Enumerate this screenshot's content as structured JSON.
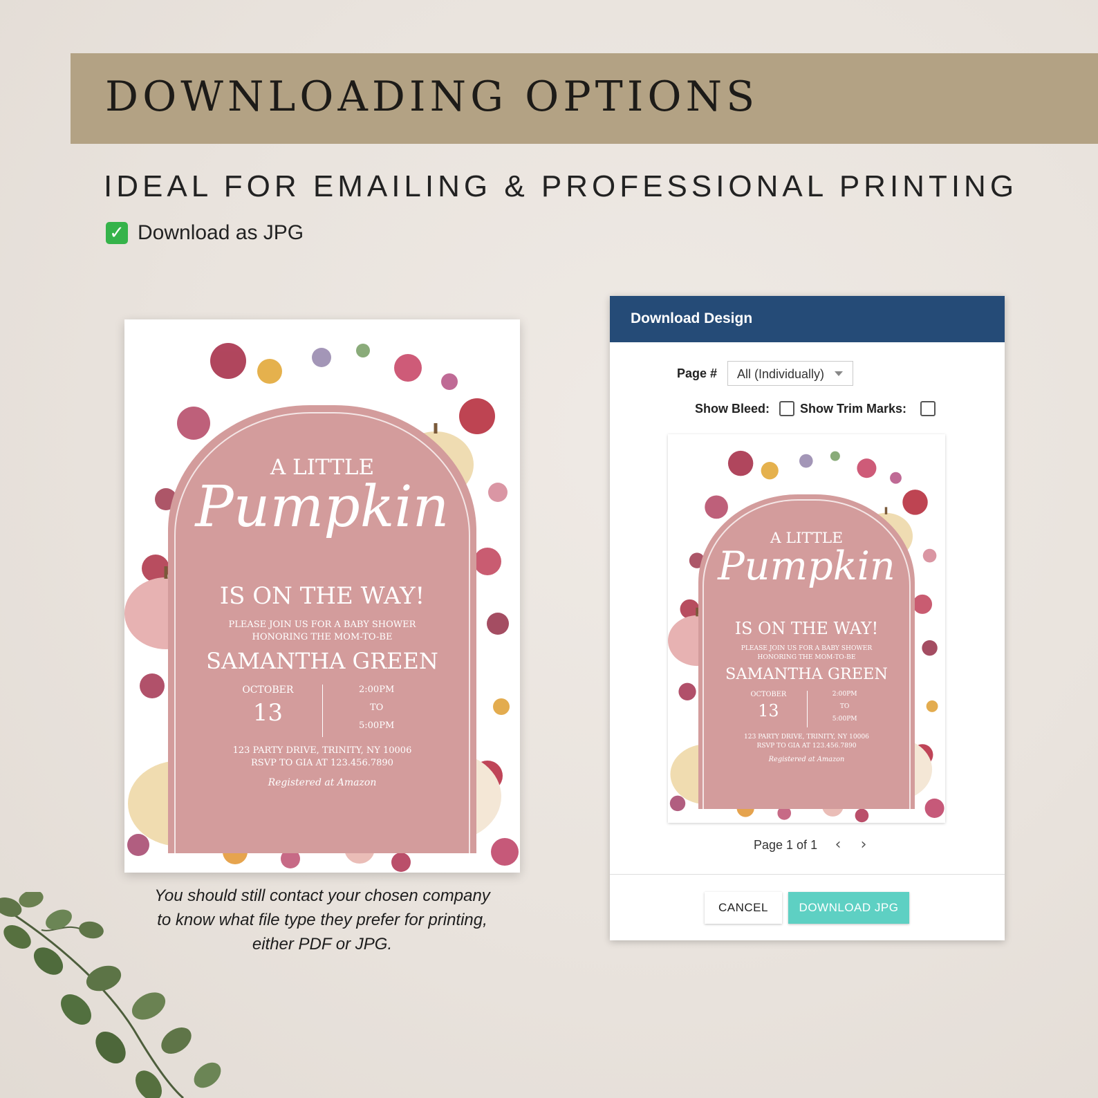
{
  "banner": {
    "title": "DOWNLOADING OPTIONS"
  },
  "subtitle": "IDEAL FOR EMAILING & PROFESSIONAL PRINTING",
  "format_line": {
    "icon": "check-mark-icon",
    "text": "Download as JPG"
  },
  "invitation": {
    "line1": "A LITTLE",
    "script": "Pumpkin",
    "line2": "IS ON THE WAY!",
    "line3": "PLEASE JOIN US FOR A BABY SHOWER",
    "line4": "HONORING THE MOM-TO-BE",
    "name": "SAMANTHA GREEN",
    "month": "OCTOBER",
    "day": "13",
    "time_start": "2:00PM",
    "time_to": "TO",
    "time_end": "5:00PM",
    "address": "123 PARTY DRIVE, TRINITY, NY 10006",
    "rsvp": "RSVP TO GIA AT 123.456.7890",
    "registry": "Registered at Amazon"
  },
  "caption": [
    "You should still contact your chosen company",
    "to know what file type they prefer for printing,",
    "either PDF or JPG."
  ],
  "dialog": {
    "title": "Download Design",
    "page_label": "Page #",
    "page_value": "All (Individually)",
    "bleed_label": "Show Bleed:",
    "trim_label": "Show Trim Marks:",
    "pager": "Page 1 of 1",
    "prev": "‹",
    "next": "›",
    "cancel": "CANCEL",
    "download": "DOWNLOAD JPG"
  },
  "colors": {
    "banner": "#b3a284",
    "header": "#254b77",
    "download_button": "#5ed0c3",
    "arch": "#d39c9c"
  }
}
